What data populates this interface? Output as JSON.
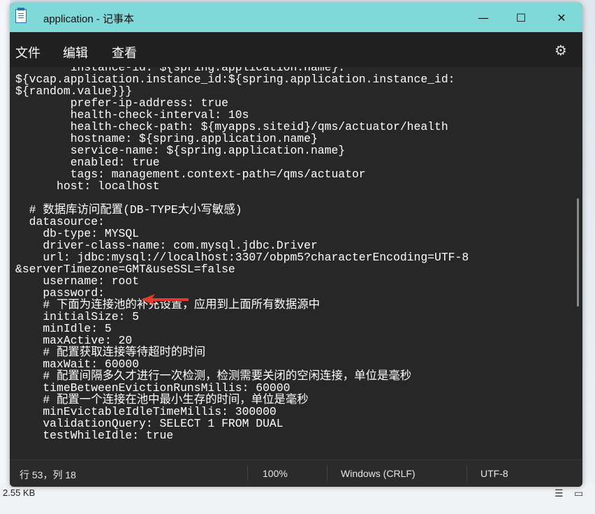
{
  "window": {
    "title": "application - 记事本",
    "controls": {
      "minimize": "—",
      "maximize": "☐",
      "close": "✕"
    }
  },
  "menu": {
    "file": "文件",
    "edit": "编辑",
    "view": "查看",
    "settings_icon": "gear-icon"
  },
  "editor": {
    "lines": [
      "        instance-id: ${spring.application.name}:",
      "${vcap.application.instance_id:${spring.application.instance_id:",
      "${random.value}}}",
      "        prefer-ip-address: true",
      "        health-check-interval: 10s",
      "        health-check-path: ${myapps.siteid}/qms/actuator/health",
      "        hostname: ${spring.application.name}",
      "        service-name: ${spring.application.name}",
      "        enabled: true",
      "        tags: management.context-path=/qms/actuator",
      "      host: localhost",
      "",
      "  # 数据库访问配置(DB-TYPE大小写敏感)",
      "  datasource:",
      "    db-type: MYSQL",
      "    driver-class-name: com.mysql.jdbc.Driver",
      "    url: jdbc:mysql://localhost:3307/obpm5?characterEncoding=UTF-8",
      "&serverTimezone=GMT&useSSL=false",
      "    username: root",
      "    password:",
      "    # 下面为连接池的补充设置，应用到上面所有数据源中",
      "    initialSize: 5",
      "    minIdle: 5",
      "    maxActive: 20",
      "    # 配置获取连接等待超时的时间",
      "    maxWait: 60000",
      "    # 配置间隔多久才进行一次检测，检测需要关闭的空闲连接，单位是毫秒",
      "    timeBetweenEvictionRunsMillis: 60000",
      "    # 配置一个连接在池中最小生存的时间，单位是毫秒",
      "    minEvictableIdleTimeMillis: 300000",
      "    validationQuery: SELECT 1 FROM DUAL",
      "    testWhileIdle: true"
    ]
  },
  "status": {
    "position": "行 53，列 18",
    "zoom": "100%",
    "line_ending": "Windows (CRLF)",
    "encoding": "UTF-8"
  },
  "background": {
    "file_size": "2.55 KB"
  },
  "colors": {
    "titlebar": "#7fd9d9",
    "editor_bg": "#272727",
    "arrow": "#e23b2e"
  }
}
